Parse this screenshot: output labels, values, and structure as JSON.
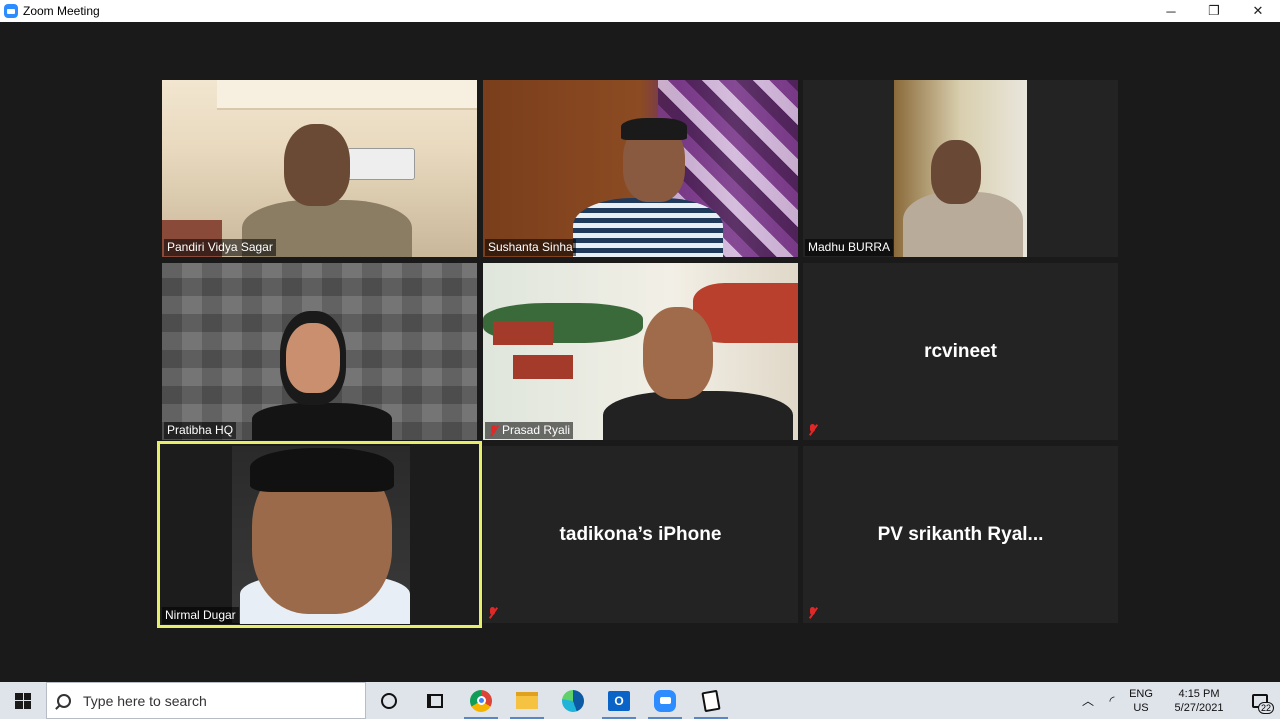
{
  "window": {
    "title": "Zoom Meeting",
    "controls": {
      "minimize": "─",
      "restore": "❐",
      "close": "✕"
    }
  },
  "participants": [
    {
      "name": "Pandiri Vidya Sagar",
      "video": true,
      "muted": false
    },
    {
      "name": "Sushanta Sinha",
      "video": true,
      "muted": false
    },
    {
      "name": "Madhu BURRA",
      "video": true,
      "muted": false
    },
    {
      "name": "Pratibha HQ",
      "video": true,
      "muted": false
    },
    {
      "name": "Prasad Ryali",
      "video": true,
      "muted": true
    },
    {
      "name": "rcvineet",
      "video": false,
      "muted": true
    },
    {
      "name": "Nirmal Dugar",
      "video": true,
      "muted": false,
      "active_speaker": true
    },
    {
      "name": "tadikona’s iPhone",
      "video": false,
      "muted": true
    },
    {
      "name": "PV srikanth Ryal...",
      "video": false,
      "muted": true
    }
  ],
  "colors": {
    "active_speaker_border": "#e6ef6c",
    "muted_icon": "#e02828",
    "zoom_blue": "#2d8cff"
  },
  "taskbar": {
    "search_placeholder": "Type here to search",
    "pinned_icons": [
      "cortana-icon",
      "task-view-icon",
      "chrome-icon",
      "file-explorer-icon",
      "edge-icon",
      "outlook-icon",
      "zoom-icon",
      "solitaire-icon"
    ],
    "tray": {
      "language": "ENG",
      "region": "US",
      "time": "4:15 PM",
      "date": "5/27/2021",
      "notification_count": "22"
    }
  }
}
